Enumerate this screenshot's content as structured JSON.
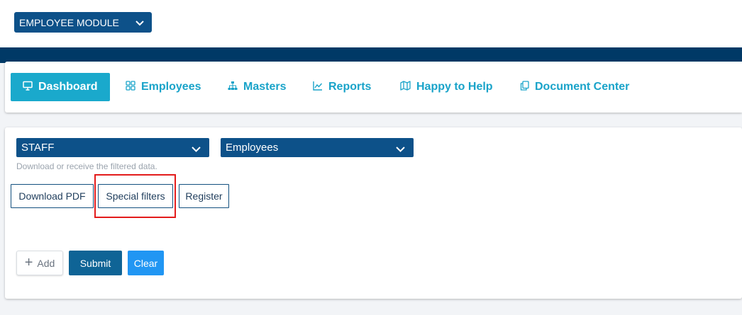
{
  "module_selector": {
    "label": "EMPLOYEE MODULE",
    "icon": "chevron-down-icon"
  },
  "nav": {
    "items": [
      {
        "label": "Dashboard",
        "icon": "monitor-icon",
        "active": true
      },
      {
        "label": "Employees",
        "icon": "grid-icon"
      },
      {
        "label": "Masters",
        "icon": "sitemap-icon"
      },
      {
        "label": "Reports",
        "icon": "chart-line-icon"
      },
      {
        "label": "Happy to Help",
        "icon": "map-icon"
      },
      {
        "label": "Document Center",
        "icon": "copy-icon"
      }
    ]
  },
  "filters": {
    "category": {
      "value": "STAFF"
    },
    "entity": {
      "value": "Employees"
    },
    "hint": "Download or receive the filtered data."
  },
  "actions": {
    "download_pdf": "Download PDF",
    "special_filters": "Special filters",
    "register": "Register"
  },
  "form_buttons": {
    "add": "Add",
    "submit": "Submit",
    "clear": "Clear"
  },
  "colors": {
    "navy": "#0d5189",
    "band": "#003966",
    "accent": "#1aa9cc",
    "highlight": "#e31b1b",
    "clear": "#2196f3"
  }
}
